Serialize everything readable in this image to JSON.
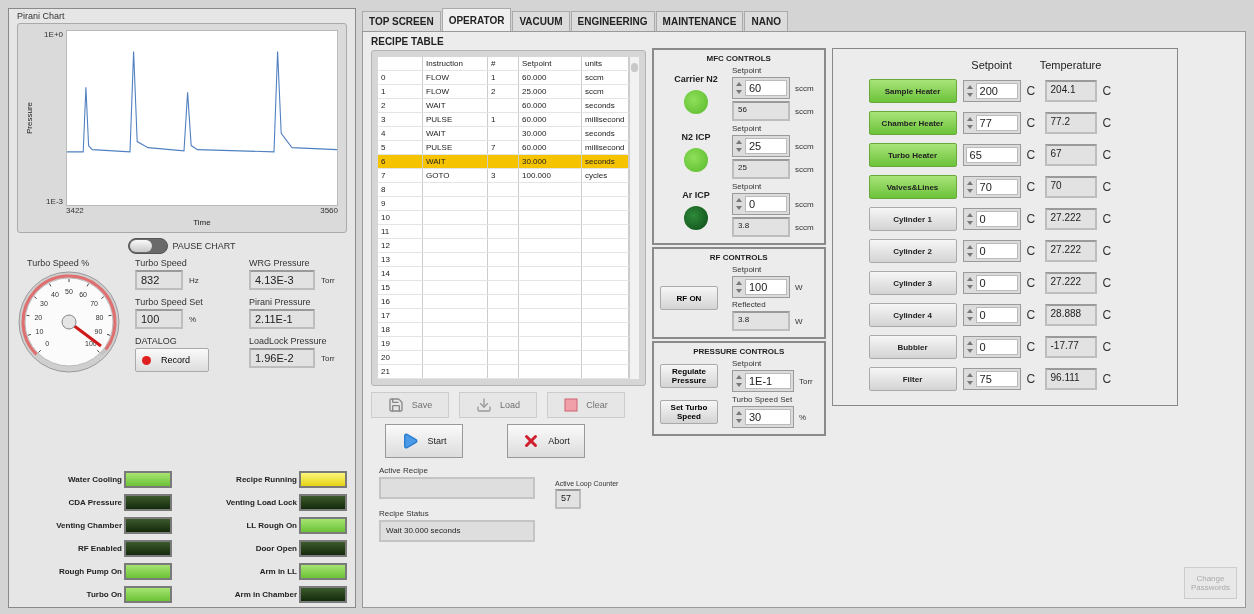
{
  "chart_panel": {
    "title": "Pirani Chart",
    "ylabel": "Pressure",
    "xlabel": "Time",
    "y_ticks": [
      "1E+0",
      "1E-3"
    ],
    "x_ticks": [
      "3422",
      "3560"
    ]
  },
  "pause_chart": {
    "label": "PAUSE CHART",
    "on": false
  },
  "turbo_gauge": {
    "label": "Turbo Speed %",
    "ticks": [
      "0",
      "10",
      "20",
      "30",
      "40",
      "50",
      "60",
      "70",
      "80",
      "90",
      "100"
    ],
    "level": 0.97
  },
  "readings": [
    {
      "label": "Turbo Speed",
      "value": "832",
      "unit": "Hz"
    },
    {
      "label": "Turbo Speed Set",
      "value": "100",
      "unit": "%"
    }
  ],
  "datalog": {
    "label": "DATALOG",
    "button": "Record"
  },
  "pressures": [
    {
      "label": "WRG Pressure",
      "value": "4.13E-3",
      "unit": "Torr"
    },
    {
      "label": "Pirani Pressure",
      "value": "2.11E-1"
    },
    {
      "label": "LoadLock Pressure",
      "value": "1.96E-2",
      "unit": "Torr"
    }
  ],
  "indicator_columns": [
    [
      {
        "label": "Water Cooling",
        "kind": "status",
        "on": true
      },
      {
        "label": "CDA Pressure",
        "kind": "status",
        "on": false
      },
      {
        "label": "Venting Chamber",
        "kind": "status",
        "on": false
      },
      {
        "label": "RF Enabled",
        "kind": "status",
        "on": false
      },
      {
        "label": "Rough Pump On",
        "kind": "status",
        "on": true
      },
      {
        "label": "Turbo On",
        "kind": "status",
        "on": true
      }
    ],
    [
      {
        "label": "Recipe Running",
        "kind": "run",
        "on": true
      },
      {
        "label": "Venting Load Lock",
        "kind": "status",
        "on": false
      },
      {
        "label": "LL Rough On",
        "kind": "status",
        "on": true
      },
      {
        "label": "Door Open",
        "kind": "status",
        "on": false
      },
      {
        "label": "Arm in LL",
        "kind": "status",
        "on": true
      },
      {
        "label": "Arm in Chamber",
        "kind": "status",
        "on": false
      }
    ]
  ],
  "tabs": [
    {
      "label": "TOP SCREEN",
      "selected": false
    },
    {
      "label": "OPERATOR",
      "selected": true
    },
    {
      "label": "VACUUM",
      "selected": false
    },
    {
      "label": "ENGINEERING",
      "selected": false
    },
    {
      "label": "MAINTENANCE",
      "selected": false
    },
    {
      "label": "NANO",
      "selected": false
    }
  ],
  "recipe_table": {
    "title": "RECIPE TABLE",
    "columns": [
      "Instruction",
      "#",
      "Setpoint",
      "units"
    ],
    "rows": [
      {
        "index": "0",
        "instruction": "FLOW",
        "number": "1",
        "setpoint": "60.000",
        "units": "sccm",
        "selected": false
      },
      {
        "index": "1",
        "instruction": "FLOW",
        "number": "2",
        "setpoint": "25.000",
        "units": "sccm",
        "selected": false
      },
      {
        "index": "2",
        "instruction": "WAIT",
        "setpoint": "60.000",
        "units": "seconds",
        "selected": false
      },
      {
        "index": "3",
        "instruction": "PULSE",
        "number": "1",
        "setpoint": "60.000",
        "units": "millisecond",
        "selected": false
      },
      {
        "index": "4",
        "instruction": "WAIT",
        "setpoint": "30.000",
        "units": "seconds",
        "selected": false
      },
      {
        "index": "5",
        "instruction": "PULSE",
        "number": "7",
        "setpoint": "60.000",
        "units": "millisecond",
        "selected": false
      },
      {
        "index": "6",
        "instruction": "WAIT",
        "setpoint": "30.000",
        "units": "seconds",
        "selected": true
      },
      {
        "index": "7",
        "instruction": "GOTO",
        "number": "3",
        "setpoint": "100.000",
        "units": "cycles",
        "selected": false
      },
      {
        "index": "8",
        "selected": false
      },
      {
        "index": "9",
        "selected": false
      },
      {
        "index": "10",
        "selected": false
      },
      {
        "index": "11",
        "selected": false
      },
      {
        "index": "12",
        "selected": false
      },
      {
        "index": "13",
        "selected": false
      },
      {
        "index": "14",
        "selected": false
      },
      {
        "index": "15",
        "selected": false
      },
      {
        "index": "16",
        "selected": false
      },
      {
        "index": "17",
        "selected": false
      },
      {
        "index": "18",
        "selected": false
      },
      {
        "index": "19",
        "selected": false
      },
      {
        "index": "20",
        "selected": false
      },
      {
        "index": "21",
        "selected": false
      }
    ]
  },
  "file_buttons": [
    {
      "label": "Save",
      "kind": "save",
      "disabled": true
    },
    {
      "label": "Load",
      "kind": "load",
      "disabled": true
    },
    {
      "label": "Clear",
      "kind": "clear",
      "disabled": true
    }
  ],
  "run_buttons": [
    {
      "label": "Start",
      "kind": "start",
      "disabled": false
    },
    {
      "label": "Abort",
      "kind": "abort",
      "disabled": false
    }
  ],
  "active_recipe": {
    "label": "Active Recipe"
  },
  "loop_counter": {
    "label": "Active Loop Counter",
    "value": "57"
  },
  "recipe_status": {
    "label": "Recipe Status",
    "value": "Wait 30.000 seconds"
  },
  "mfc_controls": {
    "title": "MFC CONTROLS",
    "gases": [
      {
        "name": "Carrier N2",
        "on": true,
        "setpoint_label": "Setpoint",
        "setpoint": "60",
        "setpoint_unit": "sccm",
        "reading": "56",
        "reading_unit": "sccm"
      },
      {
        "name": "N2 ICP",
        "on": true,
        "setpoint_label": "Setpoint",
        "setpoint": "25",
        "setpoint_unit": "sccm",
        "reading": "25",
        "reading_unit": "sccm"
      },
      {
        "name": "Ar ICP",
        "on": false,
        "setpoint_label": "Setpoint",
        "setpoint": "0",
        "setpoint_unit": "sccm",
        "reading": "3.8",
        "reading_unit": "sccm"
      }
    ]
  },
  "rf_controls": {
    "title": "RF CONTROLS",
    "button": "RF ON",
    "setpoint_label": "Setpoint",
    "setpoint": "100",
    "setpoint_unit": "W",
    "reflected_label": "Reflected",
    "reflected": "3.8",
    "reflected_unit": "W"
  },
  "pressure_controls": {
    "title": "PRESSURE CONTROLS",
    "rows": [
      {
        "button": "Regulate Pressure",
        "label": "Setpoint",
        "value": "1E-1",
        "unit": "Torr"
      },
      {
        "button": "Set Turbo Speed",
        "label": "Turbo Speed Set",
        "value": "30",
        "unit": "%"
      }
    ]
  },
  "heaters": {
    "columns": [
      "Setpoint",
      "Temperature"
    ],
    "rows": [
      {
        "name": "Sample Heater",
        "on": true,
        "spinner": true,
        "setpoint": "200",
        "setpoint_unit": "C",
        "temperature": "204.1",
        "temperature_unit": "C"
      },
      {
        "name": "Chamber Heater",
        "on": true,
        "spinner": true,
        "setpoint": "77",
        "setpoint_unit": "C",
        "temperature": "77.2",
        "temperature_unit": "C"
      },
      {
        "name": "Turbo Heater",
        "on": true,
        "spinner": false,
        "setpoint": "65",
        "setpoint_unit": "C",
        "temperature": "67",
        "temperature_unit": "C"
      },
      {
        "name": "Valves&Lines",
        "on": true,
        "spinner": true,
        "setpoint": "70",
        "setpoint_unit": "C",
        "temperature": "70",
        "temperature_unit": "C"
      },
      {
        "name": "Cylinder 1",
        "on": false,
        "spinner": true,
        "setpoint": "0",
        "setpoint_unit": "C",
        "temperature": "27.222",
        "temperature_unit": "C"
      },
      {
        "name": "Cylinder 2",
        "on": false,
        "spinner": true,
        "setpoint": "0",
        "setpoint_unit": "C",
        "temperature": "27.222",
        "temperature_unit": "C"
      },
      {
        "name": "Cylinder 3",
        "on": false,
        "spinner": true,
        "setpoint": "0",
        "setpoint_unit": "C",
        "temperature": "27.222",
        "temperature_unit": "C"
      },
      {
        "name": "Cylinder 4",
        "on": false,
        "spinner": true,
        "setpoint": "0",
        "setpoint_unit": "C",
        "temperature": "28.888",
        "temperature_unit": "C"
      },
      {
        "name": "Bubbler",
        "on": false,
        "spinner": true,
        "setpoint": "0",
        "setpoint_unit": "C",
        "temperature": "-17.77",
        "temperature_unit": "C"
      },
      {
        "name": "Filter",
        "on": false,
        "spinner": true,
        "setpoint": "75",
        "setpoint_unit": "C",
        "temperature": "96.111",
        "temperature_unit": "C"
      }
    ]
  },
  "change_passwords": {
    "label": "Change Passwords",
    "disabled": true
  }
}
